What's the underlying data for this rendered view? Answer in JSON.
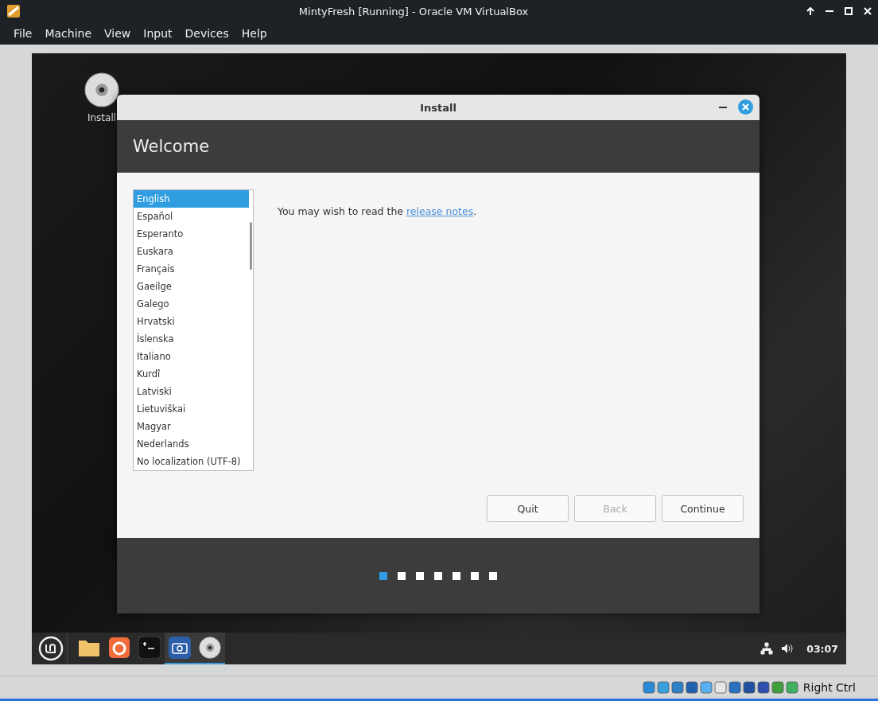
{
  "window": {
    "title": "MintyFresh [Running] - Oracle VM VirtualBox"
  },
  "menu": [
    "File",
    "Machine",
    "View",
    "Input",
    "Devices",
    "Help"
  ],
  "desktop": {
    "icons": [
      {
        "label": "Install"
      }
    ]
  },
  "dialog": {
    "title": "Install",
    "header": "Welcome",
    "languages": [
      {
        "label": "English",
        "selected": true
      },
      {
        "label": "Español",
        "selected": false
      },
      {
        "label": "Esperanto",
        "selected": false
      },
      {
        "label": "Euskara",
        "selected": false
      },
      {
        "label": "Français",
        "selected": false
      },
      {
        "label": "Gaeilge",
        "selected": false
      },
      {
        "label": "Galego",
        "selected": false
      },
      {
        "label": "Hrvatski",
        "selected": false
      },
      {
        "label": "Íslenska",
        "selected": false
      },
      {
        "label": "Italiano",
        "selected": false
      },
      {
        "label": "Kurdî",
        "selected": false
      },
      {
        "label": "Latviski",
        "selected": false
      },
      {
        "label": "Lietuviškai",
        "selected": false
      },
      {
        "label": "Magyar",
        "selected": false
      },
      {
        "label": "Nederlands",
        "selected": false
      },
      {
        "label": "No localization (UTF-8)",
        "selected": false
      }
    ],
    "message": "You may wish to read the ",
    "link": "release notes",
    "message_end": ".",
    "buttons": [
      {
        "label": "Quit",
        "disabled": false
      },
      {
        "label": "Back",
        "disabled": true
      },
      {
        "label": "Continue",
        "disabled": false
      }
    ],
    "steps": [
      {
        "selected": true
      },
      {
        "selected": false
      },
      {
        "selected": false
      },
      {
        "selected": false
      },
      {
        "selected": false
      },
      {
        "selected": false
      },
      {
        "selected": false
      }
    ]
  },
  "taskbar": {
    "apps": [
      {
        "kind": "folder",
        "running": false
      },
      {
        "kind": "browser",
        "running": false
      },
      {
        "kind": "terminal",
        "running": false
      },
      {
        "kind": "camera",
        "running": true
      },
      {
        "kind": "disc",
        "running": true
      }
    ],
    "clock": "03:07"
  },
  "status_bar": {
    "host_key": "Right Ctrl"
  }
}
